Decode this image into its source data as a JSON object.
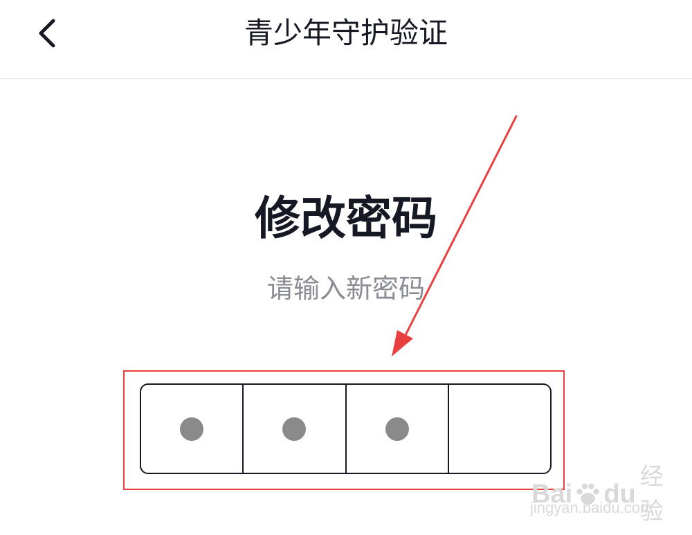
{
  "header": {
    "title": "青少年守护验证"
  },
  "main": {
    "title": "修改密码",
    "subtitle": "请输入新密码",
    "pin": {
      "length": 4,
      "filled": 3
    }
  },
  "watermark": {
    "brand_prefix": "Bai",
    "brand_suffix": "du",
    "product": "经验",
    "url": "jingyan.baidu.com"
  },
  "colors": {
    "text_primary": "#161823",
    "text_secondary": "#8a8b93",
    "dot": "#8a8a8a",
    "annotation": "#e8403f",
    "watermark": "#d9d9d9"
  },
  "icons": {
    "back": "chevron-left-icon",
    "watermark": "paw-icon"
  }
}
